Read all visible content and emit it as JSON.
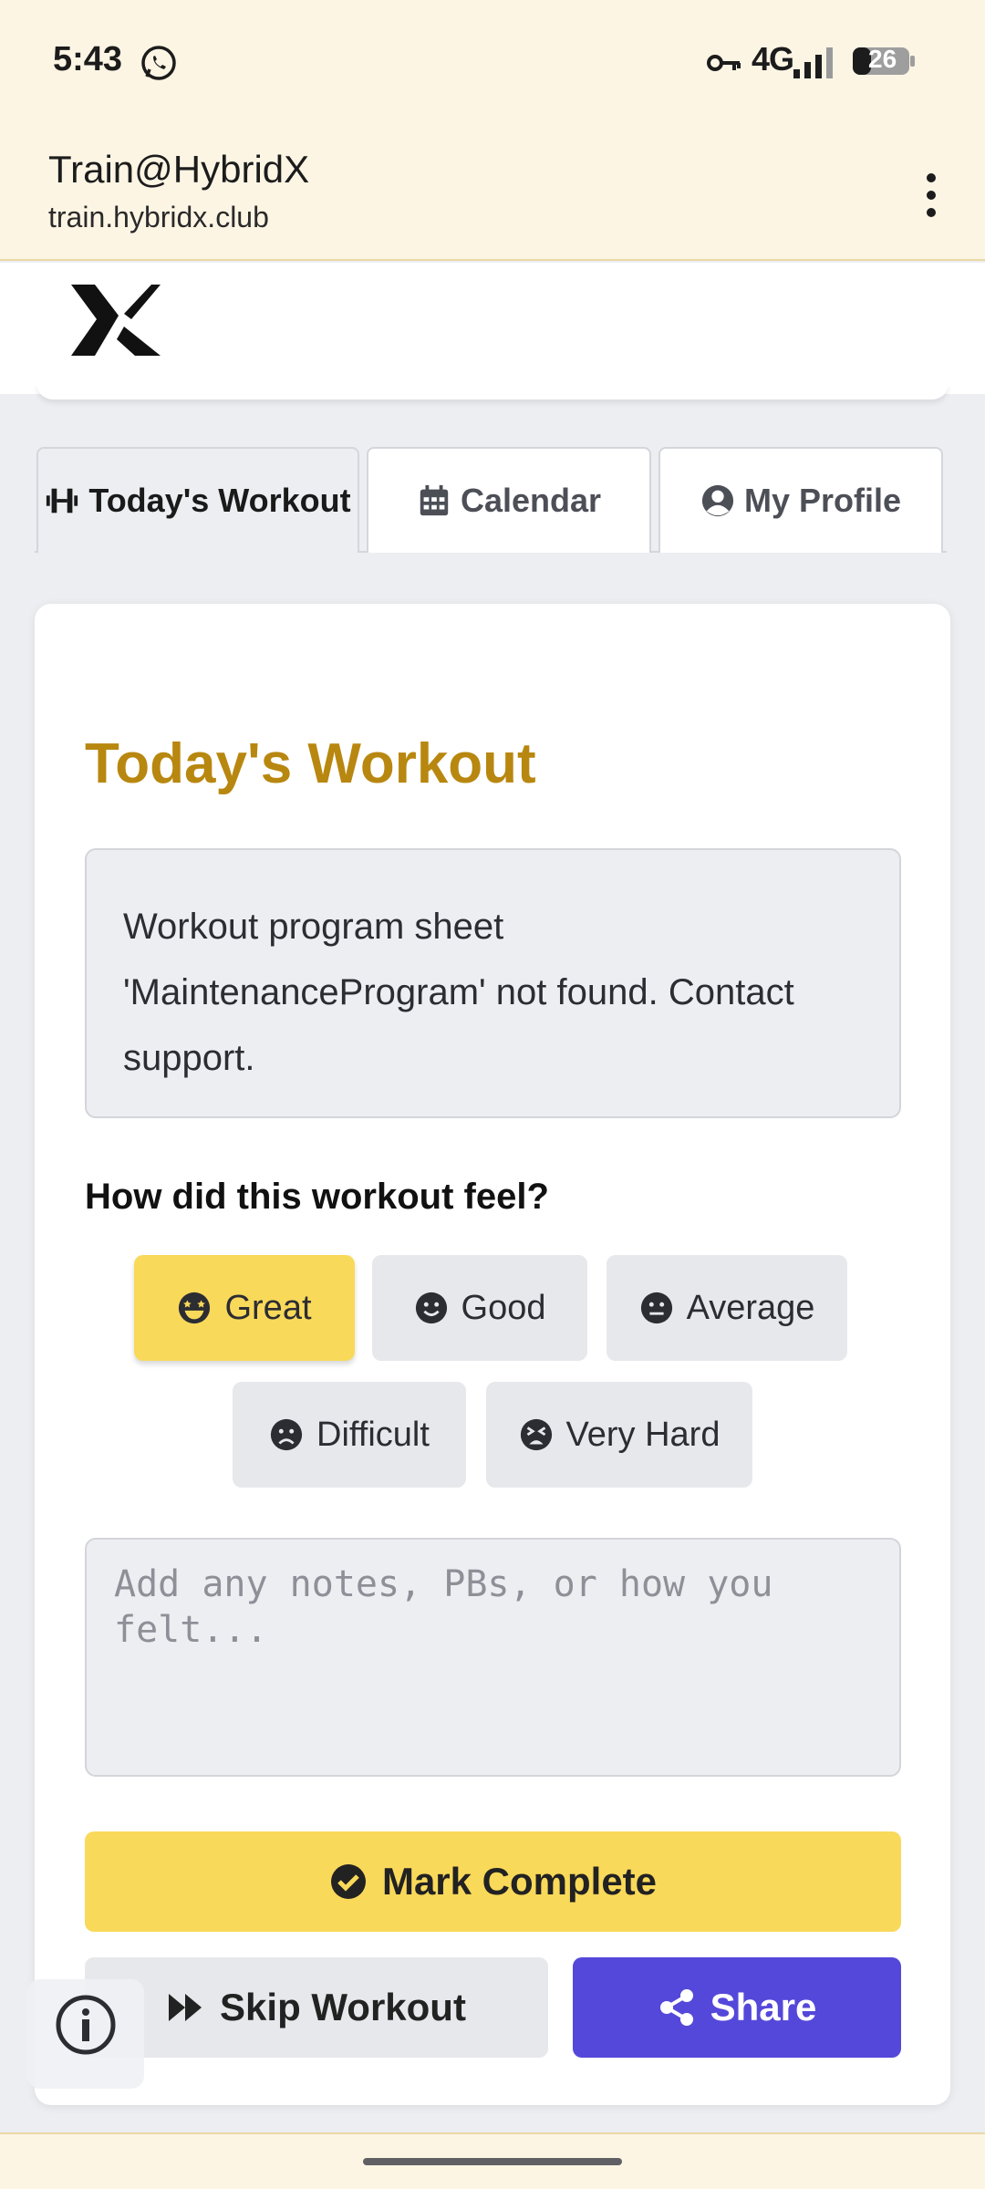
{
  "status_bar": {
    "time": "5:43",
    "network": "4G",
    "battery": "26",
    "icons": [
      "whatsapp-icon",
      "vpn-key-icon",
      "signal-icon",
      "battery-icon"
    ]
  },
  "browser": {
    "title": "Train@HybridX",
    "url": "train.hybridx.club",
    "menu_icon": "more-vert-icon"
  },
  "site": {
    "logo": "hybridx-logo"
  },
  "tabs": [
    {
      "label": "Today's Workout",
      "icon": "dumbbell-icon",
      "active": true
    },
    {
      "label": "Calendar",
      "icon": "calendar-icon",
      "active": false
    },
    {
      "label": "My Profile",
      "icon": "user-circle-icon",
      "active": false
    }
  ],
  "main": {
    "title": "Today's Workout",
    "message": "Workout program sheet 'MaintenanceProgram' not found. Contact support.",
    "feel_label": "How did this workout feel?",
    "moods": [
      {
        "label": "Great",
        "icon": "grin-stars-icon",
        "selected": true
      },
      {
        "label": "Good",
        "icon": "smile-icon",
        "selected": false
      },
      {
        "label": "Average",
        "icon": "meh-icon",
        "selected": false
      },
      {
        "label": "Difficult",
        "icon": "frown-icon",
        "selected": false
      },
      {
        "label": "Very Hard",
        "icon": "tired-icon",
        "selected": false
      }
    ],
    "notes_placeholder": "Add any notes, PBs, or how you felt...",
    "mark_complete": "Mark Complete",
    "skip": "Skip Workout",
    "share": "Share"
  },
  "colors": {
    "accent_gold": "#b8870f",
    "button_yellow": "#f9d95a",
    "share_purple": "#5448da",
    "browser_bg": "#fdf5e4"
  },
  "info_button_icon": "info-icon"
}
